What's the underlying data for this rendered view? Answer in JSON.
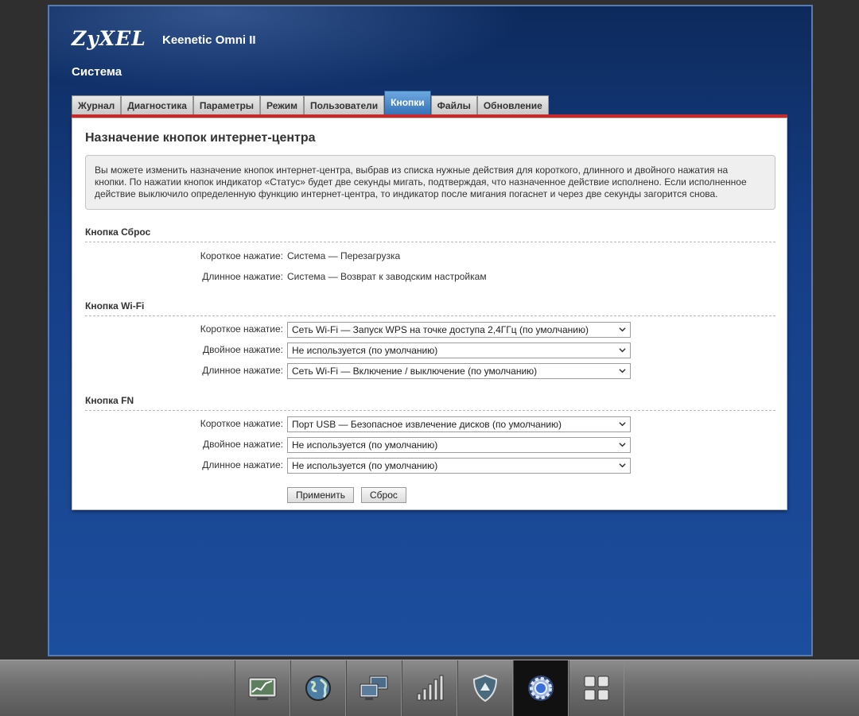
{
  "header": {
    "brand": "ZyXEL",
    "model": "Keenetic Omni II",
    "section": "Система"
  },
  "tabs": [
    "Журнал",
    "Диагностика",
    "Параметры",
    "Режим",
    "Пользователи",
    "Кнопки",
    "Файлы",
    "Обновление"
  ],
  "active_tab": "Кнопки",
  "page": {
    "title": "Назначение кнопок интернет-центра",
    "info_lines": [
      "Вы можете изменить назначение кнопок интернет-центра, выбрав из списка нужные действия для короткого, длинного и двойного нажатия на",
      "кнопки. По нажатии кнопок индикатор «Статус» будет две секунды мигать, подтверждая, что назначенное действие исполнено. Если исполненное",
      "действие выключило определенную функцию интернет-центра, то индикатор после мигания погаснет и через две секунды загорится снова."
    ]
  },
  "groups": {
    "reset": {
      "title": "Кнопка Сброс",
      "short_label": "Короткое нажатие:",
      "short_value": "Система — Перезагрузка",
      "long_label": "Длинное нажатие:",
      "long_value": "Система — Возврат к заводским настройкам"
    },
    "wifi": {
      "title": "Кнопка Wi-Fi",
      "short_label": "Короткое нажатие:",
      "short_value": "Сеть Wi-Fi — Запуск WPS на точке доступа 2,4ГГц (по умолчанию)",
      "double_label": "Двойное нажатие:",
      "double_value": "Не используется (по умолчанию)",
      "long_label": "Длинное нажатие:",
      "long_value": "Сеть Wi-Fi — Включение / выключение (по умолчанию)"
    },
    "fn": {
      "title": "Кнопка FN",
      "short_label": "Короткое нажатие:",
      "short_value": "Порт USB — Безопасное извлечение дисков (по умолчанию)",
      "double_label": "Двойное нажатие:",
      "double_value": "Не используется (по умолчанию)",
      "long_label": "Длинное нажатие:",
      "long_value": "Не используется (по умолчанию)"
    }
  },
  "buttons": {
    "apply": "Применить",
    "reset": "Сброс"
  },
  "dock": {
    "items": [
      "monitor-chart-icon",
      "globe-icon",
      "computers-icon",
      "signal-bars-icon",
      "shield-icon",
      "gear-icon",
      "apps-grid-icon"
    ],
    "active": "gear-icon"
  },
  "colors": {
    "accent_red": "#cc2b2b",
    "tab_active": "#3673b8",
    "background_blue": "#153d84"
  }
}
